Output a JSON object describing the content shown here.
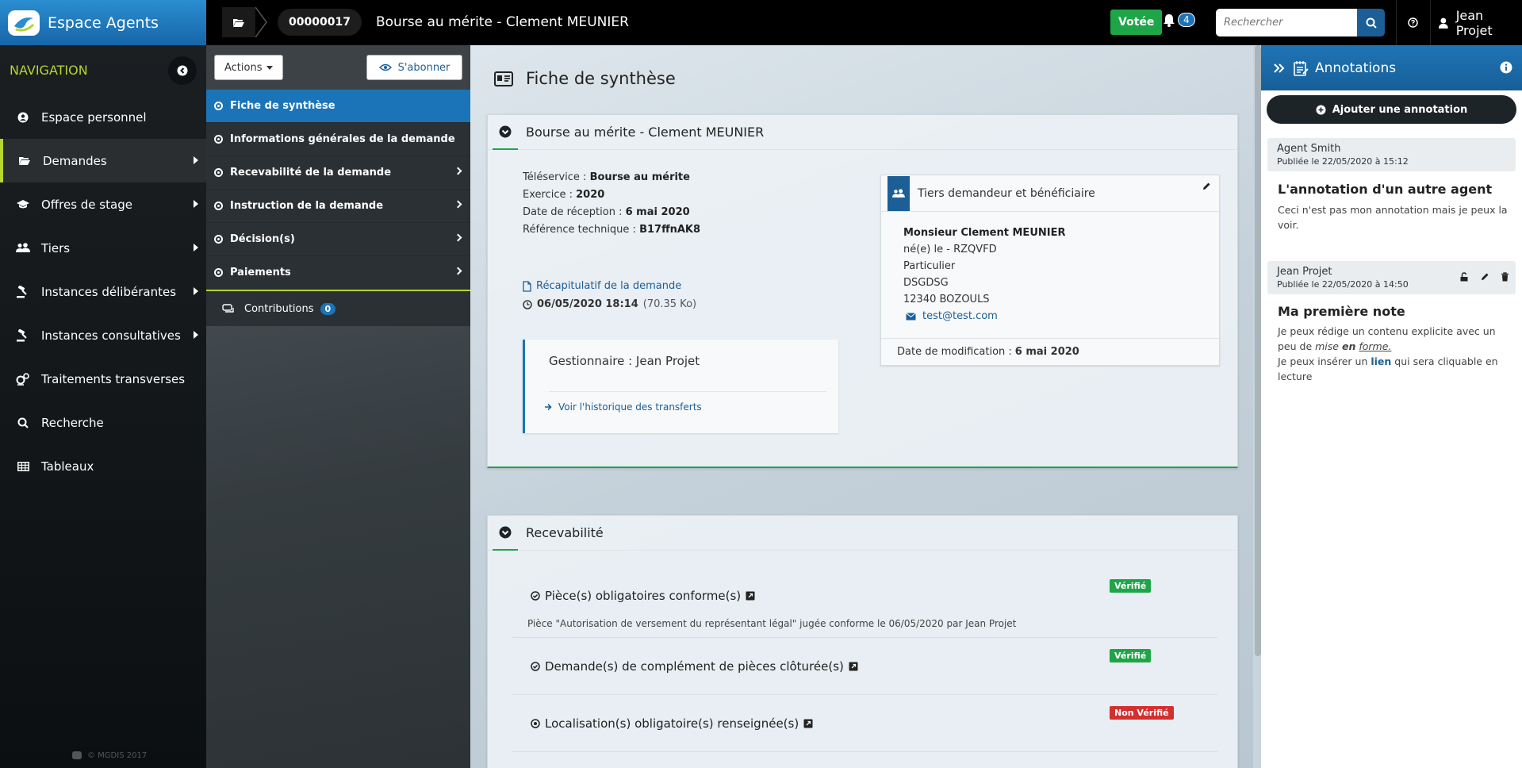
{
  "app": {
    "title": "Espace Agents"
  },
  "header": {
    "dossier_id": "00000017",
    "dossier_title": "Bourse au mérite - Clement MEUNIER",
    "status_badge": "Votée",
    "notifications_count": "4",
    "search_placeholder": "Rechercher",
    "user_name": "Jean Projet"
  },
  "nav": {
    "title": "NAVIGATION",
    "items": [
      {
        "label": "Espace personnel",
        "icon": "user-circle-icon",
        "submenu": false
      },
      {
        "label": "Demandes",
        "icon": "folder-open-icon",
        "submenu": true,
        "active": true
      },
      {
        "label": "Offres de stage",
        "icon": "graduation-cap-icon",
        "submenu": true
      },
      {
        "label": "Tiers",
        "icon": "users-icon",
        "submenu": true
      },
      {
        "label": "Instances délibérantes",
        "icon": "gavel-icon",
        "submenu": true
      },
      {
        "label": "Instances consultatives",
        "icon": "gavel-icon",
        "submenu": true
      },
      {
        "label": "Traitements transverses",
        "icon": "gears-icon",
        "submenu": false
      },
      {
        "label": "Recherche",
        "icon": "search-icon",
        "submenu": false
      },
      {
        "label": "Tableaux",
        "icon": "table-icon",
        "submenu": false
      }
    ],
    "footer": "© MGDIS 2017"
  },
  "subnav": {
    "actions_label": "Actions",
    "subscribe_label": "S'abonner",
    "items": [
      {
        "label": "Fiche de synthèse",
        "active": true,
        "chevron": false
      },
      {
        "label": "Informations générales de la demande",
        "chevron": false
      },
      {
        "label": "Recevabilité de la demande",
        "chevron": true
      },
      {
        "label": "Instruction de la demande",
        "chevron": true
      },
      {
        "label": "Décision(s)",
        "chevron": true
      },
      {
        "label": "Paiements",
        "chevron": true
      }
    ],
    "contributions_label": "Contributions",
    "contributions_count": "0"
  },
  "main": {
    "title": "Fiche de synthèse",
    "summary_panel": {
      "title": "Bourse au mérite - Clement MEUNIER",
      "fields": [
        {
          "label": "Téléservice :",
          "value": "Bourse au mérite"
        },
        {
          "label": "Exercice :",
          "value": "2020"
        },
        {
          "label": "Date de réception :",
          "value": "6 mai 2020"
        },
        {
          "label": "Référence technique :",
          "value": "B17ffnAK8"
        }
      ],
      "recap_link": "Récapitulatif de la demande",
      "recap_date": "06/05/2020 18:14",
      "recap_size": "(70.35 Ko)",
      "manager_label": "Gestionnaire : Jean Projet",
      "transfer_link": "Voir l'historique des transferts",
      "tiers": {
        "title": "Tiers demandeur et bénéficiaire",
        "name": "Monsieur Clement MEUNIER",
        "birth": "né(e) le - RZQVFD",
        "type": "Particulier",
        "address1": "DSGDSG",
        "address2": "12340 BOZOULS",
        "email": "test@test.com",
        "modified_label": "Date de modification :",
        "modified_value": "6 mai 2020"
      }
    },
    "recevabilite_panel": {
      "title": "Recevabilité",
      "checks": [
        {
          "title": "Pièce(s) obligatoires conforme(s)",
          "status": "Vérifié",
          "ok": true,
          "description": "Pièce \"Autorisation de versement du représentant légal\" jugée conforme le 06/05/2020 par Jean Projet"
        },
        {
          "title": "Demande(s) de complément de pièces clôturée(s)",
          "status": "Vérifié",
          "ok": true,
          "description": ""
        },
        {
          "title": "Localisation(s) obligatoire(s) renseignée(s)",
          "status": "Non Vérifié",
          "ok": false,
          "description": ""
        }
      ]
    }
  },
  "annotations": {
    "title": "Annotations",
    "add_label": "Ajouter une annotation",
    "notes": [
      {
        "author": "Agent Smith",
        "date": "Publiée le 22/05/2020 à 15:12",
        "title": "L'annotation d'un autre agent",
        "body": "Ceci n'est pas mon annotation mais je peux la voir."
      },
      {
        "author": "Jean Projet",
        "date": "Publiée le 22/05/2020 à 14:50",
        "title": "Ma première note",
        "body_1a": "Je peux rédige un contenu explicite avec un peu de ",
        "body_1_mise": "mise",
        "body_1_en": "en",
        "body_1_forme": "forme.",
        "body_2a": "Je peux insérer un ",
        "body_2_link": "lien",
        "body_2b": " qui sera cliquable en lecture"
      }
    ]
  },
  "colors": {
    "accent_blue": "#1c74b8",
    "green": "#1ea548",
    "red": "#d32f2f",
    "nav_accent": "#b8d42e"
  }
}
